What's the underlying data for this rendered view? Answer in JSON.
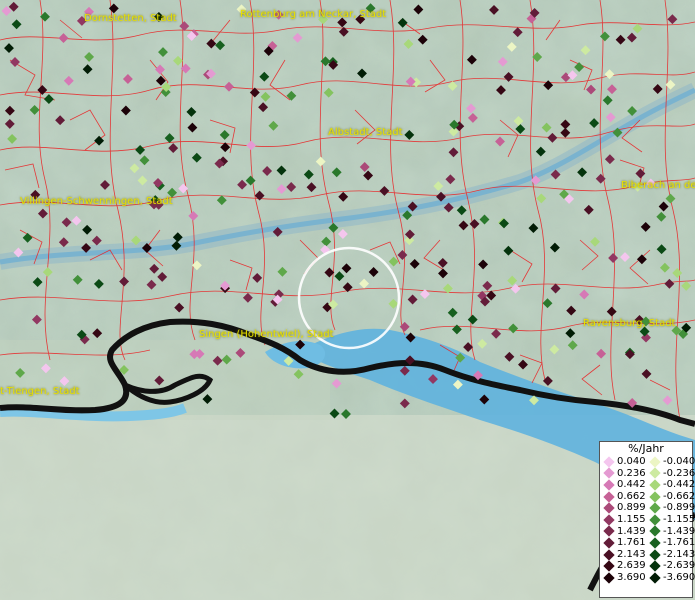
{
  "map": {
    "places": [
      {
        "id": "dornstetten",
        "label": "Dornstetten, Stadt"
      },
      {
        "id": "rottenburg",
        "label": "Rottenburg am Neckar, Stadt"
      },
      {
        "id": "albstadt",
        "label": "Albstadt, Stadt"
      },
      {
        "id": "biberach",
        "label": "Biberach an de"
      },
      {
        "id": "villingen",
        "label": "Villingen-Schwenningen, Stadt"
      },
      {
        "id": "singen",
        "label": "Singen (Hohentwiel), Stadt"
      },
      {
        "id": "ravensburg",
        "label": "Ravensburg, Stadt"
      },
      {
        "id": "tiengen",
        "label": "t-Tiengen, Stadt"
      }
    ],
    "colors": {
      "boundaries": "#e8282a",
      "border": "#111111",
      "water": "#6fb5d5",
      "lake": "#5aaad8",
      "place_label": "#e8e000"
    }
  },
  "legend": {
    "title": "%/Jahr",
    "positive": [
      {
        "label": "0.040",
        "color": "#f4c6ee"
      },
      {
        "label": "0.236",
        "color": "#e49ad2"
      },
      {
        "label": "0.442",
        "color": "#d679b6"
      },
      {
        "label": "0.662",
        "color": "#c66196"
      },
      {
        "label": "0.899",
        "color": "#ab4a79"
      },
      {
        "label": "1.155",
        "color": "#923862"
      },
      {
        "label": "1.439",
        "color": "#7a2a4c"
      },
      {
        "label": "1.761",
        "color": "#621c38"
      },
      {
        "label": "2.143",
        "color": "#4a1024"
      },
      {
        "label": "2.639",
        "color": "#350714"
      },
      {
        "label": "3.690",
        "color": "#1c0208"
      }
    ],
    "negative": [
      {
        "label": "-0.040",
        "color": "#ecf5c4"
      },
      {
        "label": "-0.236",
        "color": "#cdeaa1"
      },
      {
        "label": "-0.442",
        "color": "#a8d87a"
      },
      {
        "label": "-0.662",
        "color": "#84c35f"
      },
      {
        "label": "-0.899",
        "color": "#5fa84a"
      },
      {
        "label": "-1.155",
        "color": "#42903a"
      },
      {
        "label": "-1.439",
        "color": "#2a782c"
      },
      {
        "label": "-1.761",
        "color": "#17601f"
      },
      {
        "label": "-2.143",
        "color": "#0b4a15"
      },
      {
        "label": "-2.639",
        "color": "#04330c"
      },
      {
        "label": "-3.690",
        "color": "#011c05"
      }
    ]
  }
}
